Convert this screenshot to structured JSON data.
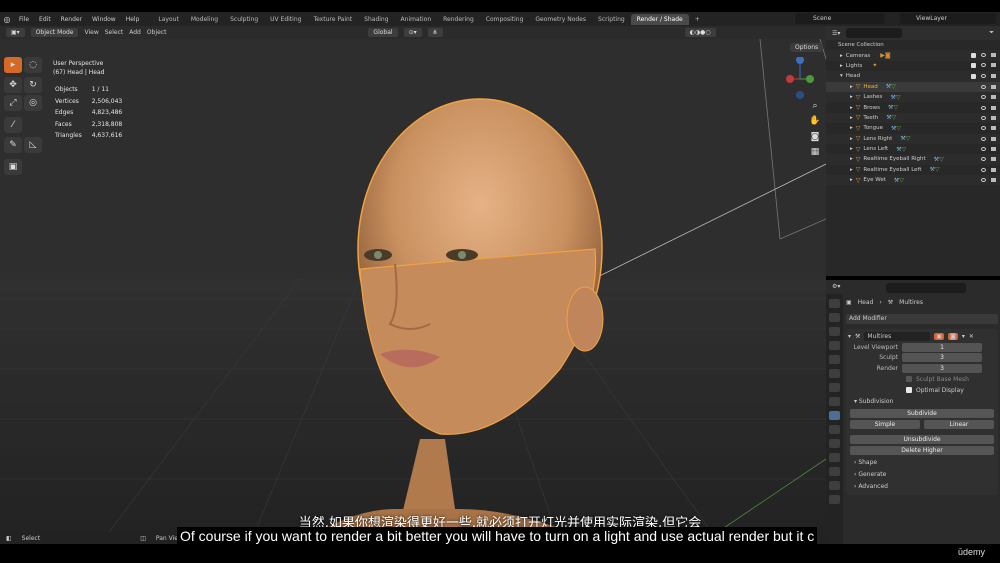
{
  "menus": [
    "File",
    "Edit",
    "Render",
    "Window",
    "Help"
  ],
  "workspaces": [
    "Layout",
    "Modeling",
    "Sculpting",
    "UV Editing",
    "Texture Paint",
    "Shading",
    "Animation",
    "Rendering",
    "Compositing",
    "Geometry Nodes",
    "Scripting",
    "Render / Shade"
  ],
  "active_workspace": "Render / Shade",
  "scene_name": "Scene",
  "view_layer": "ViewLayer",
  "header": {
    "mode": "Object Mode",
    "view": "View",
    "select": "Select",
    "add": "Add",
    "object": "Object",
    "orientation": "Global"
  },
  "viewport": {
    "perspective": "User Perspective",
    "context": "(67) Head | Head",
    "stats": [
      {
        "label": "Objects",
        "value": "1 / 11"
      },
      {
        "label": "Vertices",
        "value": "2,506,043"
      },
      {
        "label": "Edges",
        "value": "4,823,486"
      },
      {
        "label": "Faces",
        "value": "2,318,808"
      },
      {
        "label": "Triangles",
        "value": "4,637,616"
      }
    ],
    "options": "Options"
  },
  "outliner": {
    "root": "Scene Collection",
    "rows": [
      {
        "label": "Cameras",
        "indent": 1
      },
      {
        "label": "Lights",
        "indent": 1
      },
      {
        "label": "Head",
        "indent": 1
      },
      {
        "label": "Head",
        "indent": 2,
        "selected": true
      },
      {
        "label": "Lashes",
        "indent": 2
      },
      {
        "label": "Brows",
        "indent": 2
      },
      {
        "label": "Teeth",
        "indent": 2
      },
      {
        "label": "Tongue",
        "indent": 2
      },
      {
        "label": "Lens Right",
        "indent": 2
      },
      {
        "label": "Lens Left",
        "indent": 2
      },
      {
        "label": "Realtime Eyeball Right",
        "indent": 2
      },
      {
        "label": "Realtime Eyeball Left",
        "indent": 2
      },
      {
        "label": "Eye Wet",
        "indent": 2
      }
    ]
  },
  "properties": {
    "object": "Head",
    "modifier": "Multires",
    "add_modifier": "Add Modifier",
    "fields": [
      {
        "label": "Level Viewport",
        "value": "1"
      },
      {
        "label": "Sculpt",
        "value": "3"
      },
      {
        "label": "Render",
        "value": "3"
      }
    ],
    "sculpt_base_mesh": "Sculpt Base Mesh",
    "optimal_display": "Optimal Display",
    "subdivision": "Subdivision",
    "subdivide": "Subdivide",
    "simple": "Simple",
    "linear": "Linear",
    "unsubdivide": "Unsubdivide",
    "delete_higher": "Delete Higher",
    "shape": "Shape",
    "generate": "Generate",
    "advanced": "Advanced"
  },
  "status": {
    "select": "Select",
    "pan": "Pan View"
  },
  "subtitle_zh": "当然,如果你想渲染得更好一些,就必须打开灯光并使用实际渲染,但它会",
  "subtitle_en": "Of course if you want to render a bit better you will have to turn on a light and use actual render but it c",
  "watermark": "ūdemy"
}
